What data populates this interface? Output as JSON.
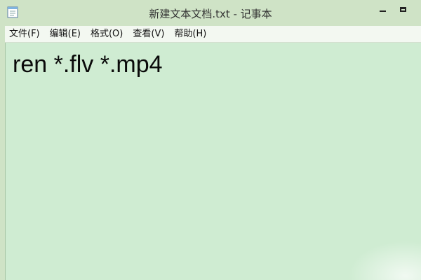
{
  "window": {
    "title": "新建文本文档.txt - 记事本"
  },
  "menu": {
    "items": [
      {
        "label": "文件(F)"
      },
      {
        "label": "编辑(E)"
      },
      {
        "label": "格式(O)"
      },
      {
        "label": "查看(V)"
      },
      {
        "label": "帮助(H)"
      }
    ]
  },
  "editor": {
    "content": "ren *.flv *.mp4"
  },
  "colors": {
    "titlebar": "#cfe3c6",
    "menubar": "#f3f8f1",
    "editor_background": "#cfecd2"
  },
  "icons": {
    "app": "notepad-icon",
    "minimize": "minimize-icon",
    "maximize": "maximize-icon"
  }
}
